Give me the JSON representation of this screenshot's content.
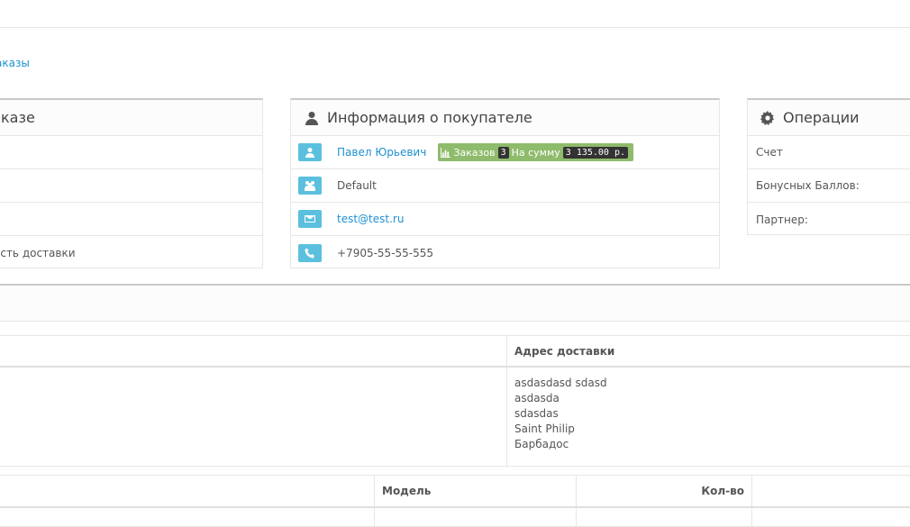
{
  "breadcrumb": {
    "last": "аказы"
  },
  "order_panel": {
    "title_fragment": "казе",
    "rows": [
      "",
      "",
      "",
      "ость доставки"
    ]
  },
  "customer_panel": {
    "title": "Информация о покупателе",
    "name": "Павел Юрьевич",
    "orders_label": "Заказов",
    "orders_count": "3",
    "sum_label": "На сумму",
    "sum_value": "3 135.00 р.",
    "group": "Default",
    "email": "test@test.ru",
    "phone": "+7905-55-55-555"
  },
  "operations_panel": {
    "title": "Операции",
    "rows": [
      "Счет",
      "Бонусных Баллов:",
      "Партнер:"
    ]
  },
  "address_table": {
    "col_left": "",
    "col_right": "Адрес доставки",
    "address_lines": [
      "asdasdasd sdasd",
      "asdasda",
      "sdasdas",
      "Saint Philip",
      "Барбадос"
    ]
  },
  "products_table": {
    "columns": [
      "",
      "Модель",
      "Кол-во",
      ""
    ]
  },
  "colors": {
    "link": "#1e91cf",
    "icon_bg": "#5bc0de",
    "label_green": "#8fbb6c"
  }
}
